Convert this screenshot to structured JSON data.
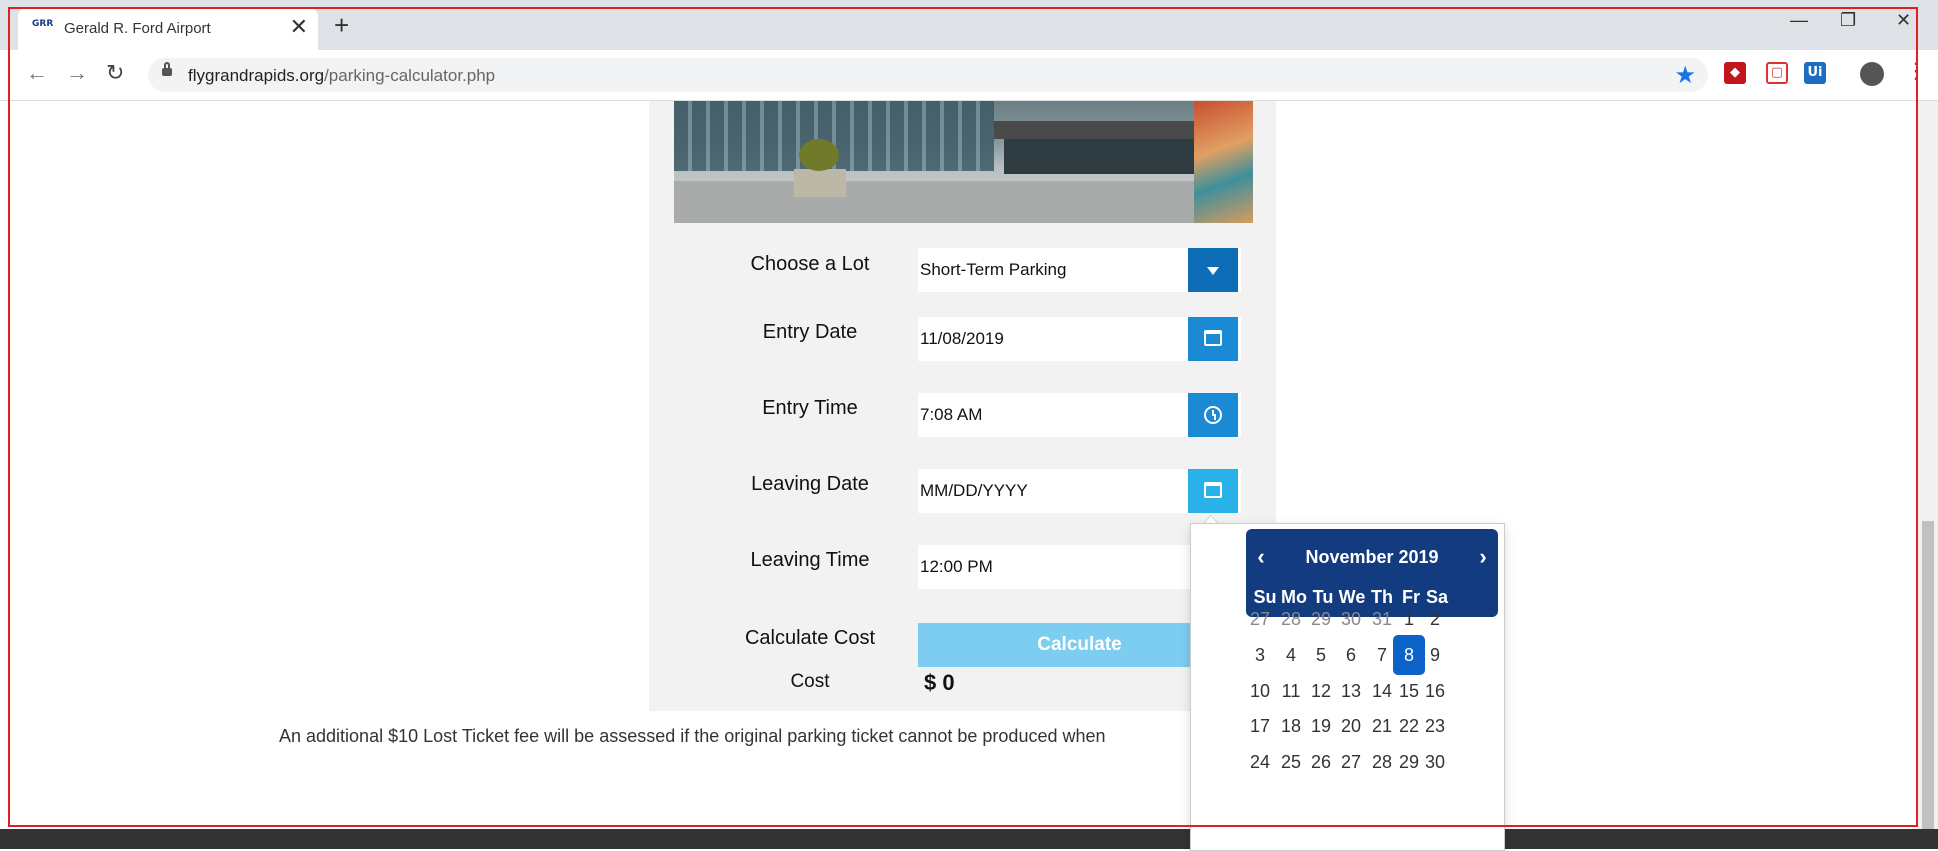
{
  "browser": {
    "tab_title": "Gerald R. Ford Airport",
    "favicon_text": "GRR",
    "url_domain": "flygrandrapids.org",
    "url_path": "/parking-calculator.php",
    "close_glyph": "✕",
    "new_tab_glyph": "+",
    "minimize_glyph": "—",
    "restore_glyph": "❐",
    "window_close_glyph": "✕",
    "back_glyph": "←",
    "forward_glyph": "→",
    "reload_glyph": "↻",
    "star_glyph": "★",
    "kebab_glyph": "⋮",
    "extensions": [
      {
        "name": "shield-extension-icon",
        "color": "#c0161c",
        "glyph": "◆"
      },
      {
        "name": "pocket-extension-icon",
        "color": "#ffffff",
        "glyph": "▢"
      },
      {
        "name": "uipath-extension-icon",
        "color": "#1a6fc2",
        "glyph": "Ui"
      }
    ]
  },
  "form": {
    "lot": {
      "label": "Choose a Lot",
      "value": "Short-Term Parking"
    },
    "entry_date": {
      "label": "Entry Date",
      "value": "11/08/2019"
    },
    "entry_time": {
      "label": "Entry Time",
      "value": "7:08 AM"
    },
    "leaving_date": {
      "label": "Leaving Date",
      "placeholder": "MM/DD/YYYY"
    },
    "leaving_time": {
      "label": "Leaving Time",
      "value": "12:00 PM"
    },
    "calculate": {
      "label": "Calculate Cost",
      "button": "Calculate"
    },
    "cost": {
      "label": "Cost",
      "value": "$ 0"
    }
  },
  "note": "An additional $10 Lost Ticket fee will be assessed if the original parking ticket cannot be produced when",
  "datepicker": {
    "title": "November 2019",
    "prev": "‹",
    "next": "›",
    "weekdays": [
      "Su",
      "Mo",
      "Tu",
      "We",
      "Th",
      "Fr",
      "Sa"
    ],
    "weeks": [
      [
        "27",
        "28",
        "29",
        "30",
        "31",
        "1",
        "2"
      ],
      [
        "3",
        "4",
        "5",
        "6",
        "7",
        "8",
        "9"
      ],
      [
        "10",
        "11",
        "12",
        "13",
        "14",
        "15",
        "16"
      ],
      [
        "17",
        "18",
        "19",
        "20",
        "21",
        "22",
        "23"
      ],
      [
        "24",
        "25",
        "26",
        "27",
        "28",
        "29",
        "30"
      ]
    ],
    "muted_days": [
      "27",
      "28",
      "29",
      "30",
      "31"
    ],
    "selected_day": "8"
  },
  "colors": {
    "accent": "#1a8ad4",
    "header": "#133b7f",
    "selected": "#0b62c8",
    "calc_button": "#7ccdf0"
  }
}
